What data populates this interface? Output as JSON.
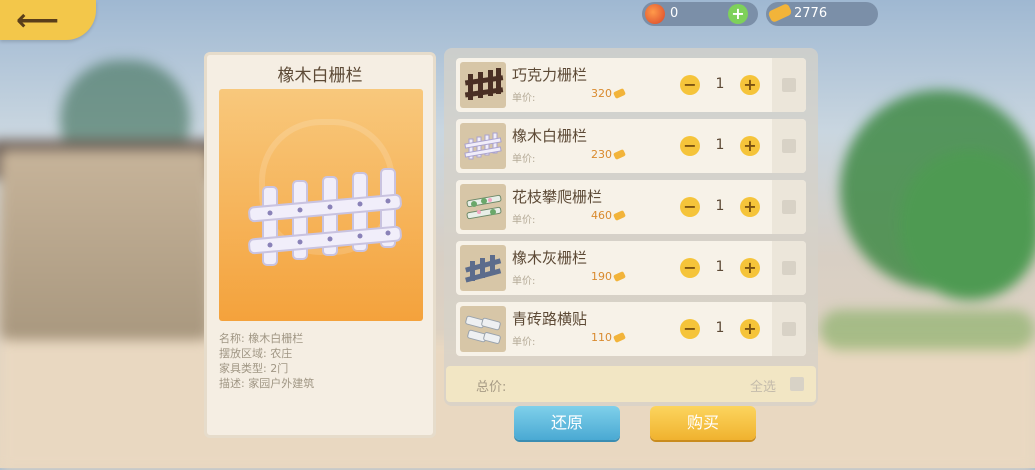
{
  "currency": {
    "coins": "0",
    "gold": "2776"
  },
  "selected": {
    "title": "橡木白栅栏",
    "details": [
      {
        "label": "名称:",
        "value": "橡木白栅栏"
      },
      {
        "label": "摆放区域:",
        "value": "农庄"
      },
      {
        "label": "家具类型:",
        "value": "2门"
      },
      {
        "label": "描述:",
        "value": "家园户外建筑"
      }
    ]
  },
  "items": [
    {
      "name": "巧克力栅栏",
      "price_label": "单价:",
      "price": "320",
      "quantity": "1",
      "icon": "chocolate-fence-icon"
    },
    {
      "name": "橡木白栅栏",
      "price_label": "单价:",
      "price": "230",
      "quantity": "1",
      "icon": "white-oak-fence-icon"
    },
    {
      "name": "花枝攀爬栅栏",
      "price_label": "单价:",
      "price": "460",
      "quantity": "1",
      "icon": "flower-vine-fence-icon"
    },
    {
      "name": "橡木灰栅栏",
      "price_label": "单价:",
      "price": "190",
      "quantity": "1",
      "icon": "gray-oak-fence-icon"
    },
    {
      "name": "青砖路横贴",
      "price_label": "单价:",
      "price": "110",
      "quantity": "1",
      "icon": "blue-brick-path-icon"
    }
  ],
  "footer": {
    "total_label": "总价:",
    "select_all_label": "全选",
    "restore_label": "还原",
    "buy_label": "购买"
  },
  "colors": {
    "accent_yellow": "#f5c43a",
    "restore_blue": "#4aa9d3",
    "preview_orange": "#f4a23c"
  }
}
